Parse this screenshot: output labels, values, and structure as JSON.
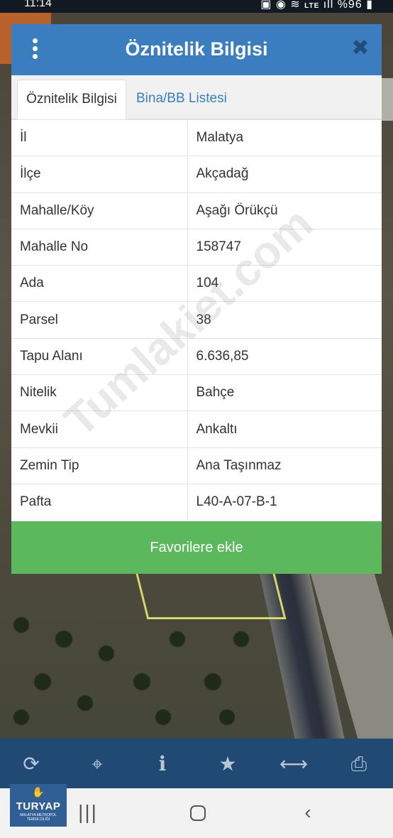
{
  "status_bar": {
    "time": "11:14",
    "network": "LTE",
    "battery": "%96"
  },
  "dialog": {
    "title": "Öznitelik Bilgisi",
    "close_icon": "close-icon",
    "tabs": [
      {
        "label": "Öznitelik Bilgisi",
        "active": true
      },
      {
        "label": "Bina/BB Listesi",
        "active": false
      }
    ],
    "rows": [
      {
        "key": "İl",
        "value": "Malatya"
      },
      {
        "key": "İlçe",
        "value": "Akçadağ"
      },
      {
        "key": "Mahalle/Köy",
        "value": "Aşağı Örükçü"
      },
      {
        "key": "Mahalle No",
        "value": "158747"
      },
      {
        "key": "Ada",
        "value": "104"
      },
      {
        "key": "Parsel",
        "value": "38"
      },
      {
        "key": "Tapu Alanı",
        "value": "6.636,85"
      },
      {
        "key": "Nitelik",
        "value": "Bahçe"
      },
      {
        "key": "Mevkii",
        "value": "Ankaltı"
      },
      {
        "key": "Zemin Tip",
        "value": "Ana Taşınmaz"
      },
      {
        "key": "Pafta",
        "value": "L40-A-07-B-1"
      }
    ],
    "favorite_button": "Favorilere ekle",
    "watermark": "Tumlakiet.com"
  },
  "toolbar": {
    "icons": [
      "refresh-icon",
      "crosshair-icon",
      "info-icon",
      "star-icon",
      "measure-icon",
      "print-icon"
    ]
  },
  "logo": {
    "name": "TURYAP",
    "subtitle": "MALATYA METROPOL TEMSİLCİLİĞİ"
  },
  "colors": {
    "header": "#3a7ec0",
    "favorite_button": "#5cb85c",
    "toolbar": "#204a74"
  }
}
